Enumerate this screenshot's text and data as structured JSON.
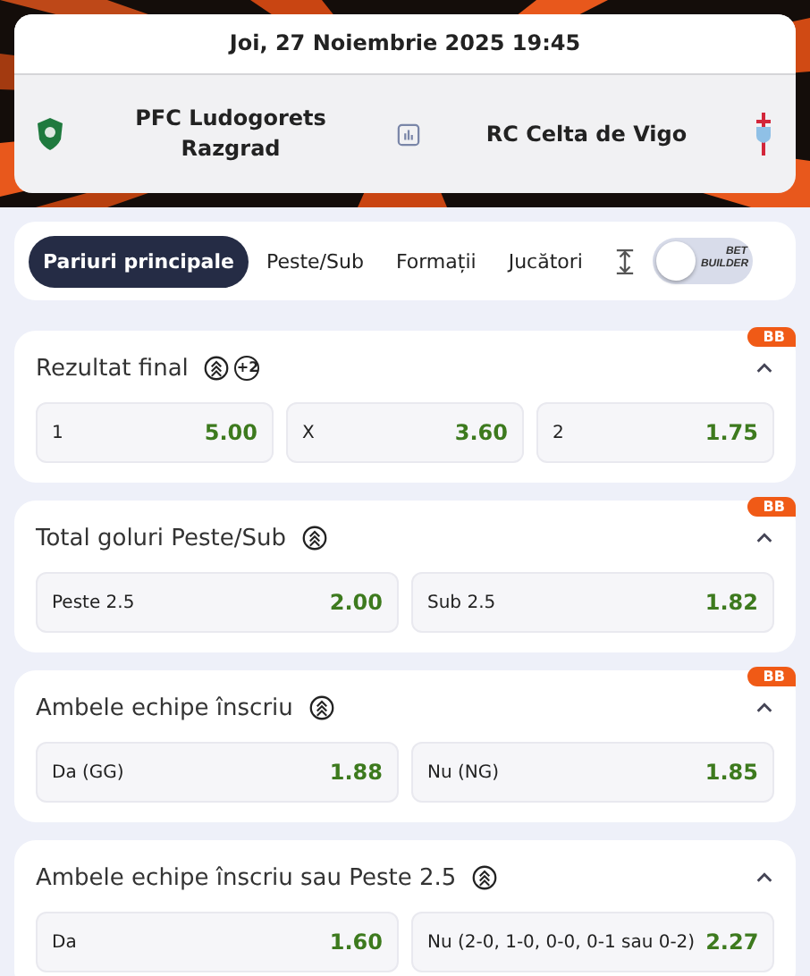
{
  "match": {
    "datetime": "Joi, 27 Noiembrie 2025 19:45",
    "home_team": "PFC Ludogorets Razgrad",
    "away_team": "RC Celta de Vigo"
  },
  "tabs": [
    {
      "label": "Pariuri principale",
      "selected": true
    },
    {
      "label": "Peste/Sub",
      "selected": false
    },
    {
      "label": "Formații",
      "selected": false
    },
    {
      "label": "Jucători",
      "selected": false
    }
  ],
  "bet_builder": {
    "label": "BET BUILDER",
    "on": false
  },
  "markets": [
    {
      "title": "Rezultat final",
      "extra_badge": "+2",
      "bb_badge": "BB",
      "expanded": true,
      "outcomes": [
        {
          "label": "1",
          "odds": "5.00"
        },
        {
          "label": "X",
          "odds": "3.60"
        },
        {
          "label": "2",
          "odds": "1.75"
        }
      ]
    },
    {
      "title": "Total goluri Peste/Sub",
      "bb_badge": "BB",
      "expanded": true,
      "outcomes": [
        {
          "label": "Peste 2.5",
          "odds": "2.00"
        },
        {
          "label": "Sub 2.5",
          "odds": "1.82"
        }
      ]
    },
    {
      "title": "Ambele echipe înscriu",
      "bb_badge": "BB",
      "expanded": true,
      "outcomes": [
        {
          "label": "Da (GG)",
          "odds": "1.88"
        },
        {
          "label": "Nu (NG)",
          "odds": "1.85"
        }
      ]
    },
    {
      "title": "Ambele echipe înscriu sau Peste 2.5",
      "expanded": true,
      "outcomes": [
        {
          "label": "Da",
          "odds": "1.60"
        },
        {
          "label": "Nu (2-0, 1-0, 0-0, 0-1 sau 0-2)",
          "odds": "2.27"
        }
      ]
    }
  ]
}
